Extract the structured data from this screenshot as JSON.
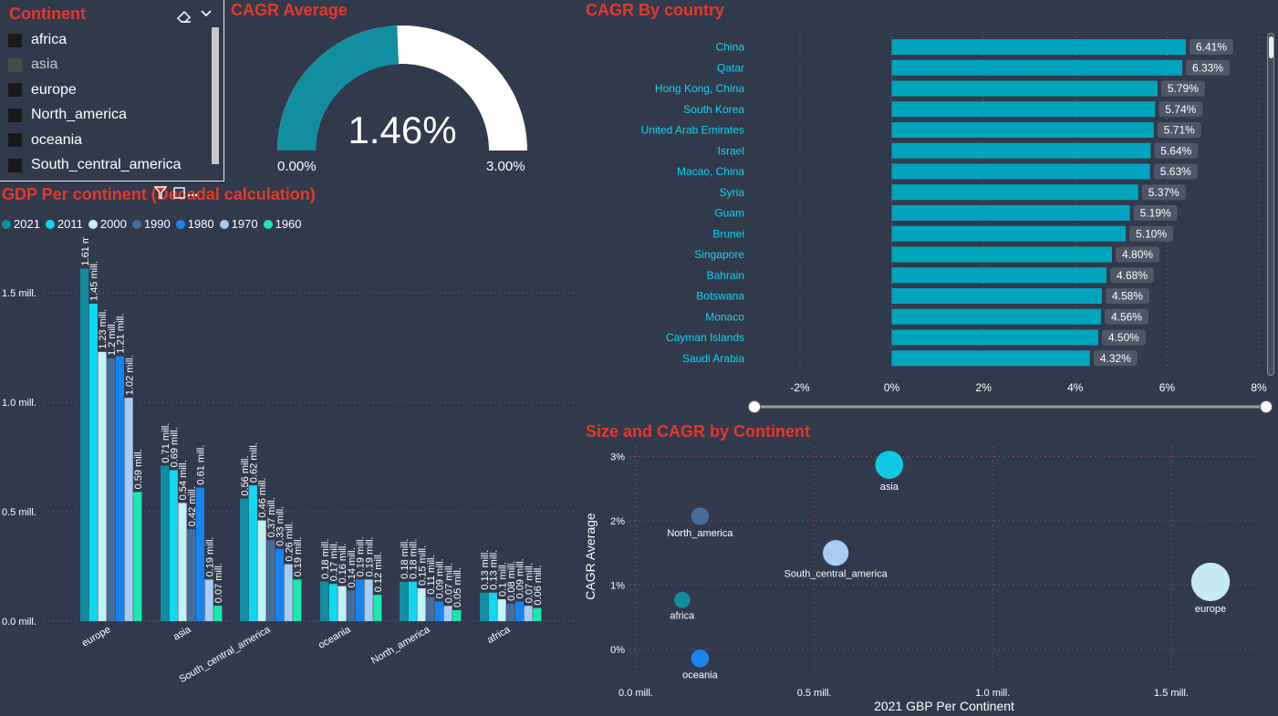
{
  "slicer": {
    "title": "Continent",
    "items": [
      {
        "label": "africa",
        "dim": false
      },
      {
        "label": "asia",
        "dim": true
      },
      {
        "label": "europe",
        "dim": false
      },
      {
        "label": "North_america",
        "dim": false
      },
      {
        "label": "oceania",
        "dim": false
      },
      {
        "label": "South_central_america",
        "dim": false
      }
    ]
  },
  "gauge": {
    "title": "CAGR Average",
    "value_label": "1.46%",
    "value": 1.46,
    "min_label": "0.00%",
    "max_label": "3.00%",
    "min": 0,
    "max": 3,
    "fill_color": "#118ea0",
    "track_color": "#ffffff"
  },
  "bar_title": "CAGR By country",
  "grouped_title": "GDP Per continent (Decadal calculation)",
  "scatter_title": "Size and CAGR by Continent",
  "chart_data": [
    {
      "type": "bar",
      "orientation": "horizontal",
      "title": "CAGR By country",
      "categories": [
        "China",
        "Qatar",
        "Hong Kong, China",
        "South Korea",
        "United Arab Emirates",
        "Israel",
        "Macao, China",
        "Syria",
        "Guam",
        "Brunei",
        "Singapore",
        "Bahrain",
        "Botswana",
        "Monaco",
        "Cayman Islands",
        "Saudi Arabia"
      ],
      "values": [
        6.41,
        6.33,
        5.79,
        5.74,
        5.71,
        5.64,
        5.63,
        5.37,
        5.19,
        5.1,
        4.8,
        4.68,
        4.58,
        4.56,
        4.5,
        4.32
      ],
      "value_labels": [
        "6.41%",
        "6.33%",
        "5.79%",
        "5.74%",
        "5.71%",
        "5.64%",
        "5.63%",
        "5.37%",
        "5.19%",
        "5.10%",
        "4.80%",
        "4.68%",
        "4.58%",
        "4.56%",
        "4.50%",
        "4.32%"
      ],
      "xlim": [
        -2,
        8
      ],
      "xticks": [
        -2,
        0,
        2,
        4,
        6,
        8
      ],
      "xtick_labels": [
        "-2%",
        "0%",
        "2%",
        "4%",
        "6%",
        "8%"
      ],
      "color": "#00a5bd",
      "grid": true
    },
    {
      "type": "bar",
      "title": "GDP Per continent (Decadal calculation)",
      "categories": [
        "europe",
        "asia",
        "South_central_america",
        "oceania",
        "North_america",
        "africa"
      ],
      "series": [
        {
          "name": "2021",
          "color": "#118ea0",
          "values": [
            1.61,
            0.71,
            0.56,
            0.18,
            0.18,
            0.13
          ]
        },
        {
          "name": "2011",
          "color": "#12d7f2",
          "values": [
            1.45,
            0.69,
            0.62,
            0.17,
            0.18,
            0.13
          ]
        },
        {
          "name": "2000",
          "color": "#c5f1f8",
          "values": [
            1.23,
            0.54,
            0.46,
            0.16,
            0.15,
            0.1
          ]
        },
        {
          "name": "1990",
          "color": "#466c9c",
          "values": [
            1.2,
            0.42,
            0.37,
            0.14,
            0.11,
            0.08
          ]
        },
        {
          "name": "1980",
          "color": "#1a83ee",
          "values": [
            1.21,
            0.61,
            0.33,
            0.19,
            0.09,
            0.09
          ]
        },
        {
          "name": "1970",
          "color": "#a7ccf5",
          "values": [
            1.02,
            0.19,
            0.26,
            0.19,
            0.07,
            0.07
          ]
        },
        {
          "name": "1960",
          "color": "#1be8b0",
          "values": [
            0.59,
            0.07,
            0.19,
            0.12,
            0.05,
            0.06
          ]
        }
      ],
      "value_labels": [
        [
          "1.61 mill.",
          "0.71 mill.",
          "0.56 mill.",
          "0.18 mill.",
          "0.18 mill.",
          "0.13 mill."
        ],
        [
          "1.45 mill.",
          "0.69 mill.",
          "0.62 mill.",
          "0.17 mill.",
          "0.18 mill.",
          "0.13 mill."
        ],
        [
          "1.23 mill.",
          "0.54 mill.",
          "0.46 mill.",
          "0.16 mill.",
          "0.15 mill.",
          "0.1 mill."
        ],
        [
          "1.2 mill.",
          "0.42 mill.",
          "0.37 mill.",
          "0.14 mill.",
          "0.11 mill.",
          "0.08 mill."
        ],
        [
          "1.21 mill.",
          "0.61 mill.",
          "0.33 mill.",
          "0.19 mill.",
          "0.09 mill.",
          "0.09 mill."
        ],
        [
          "1.02 mill.",
          "0.19 mill.",
          "0.26 mill.",
          "0.19 mill.",
          "0.07 mill.",
          "0.07 mill."
        ],
        [
          "0.59 mill.",
          "0.07 mill.",
          "0.19 mill.",
          "0.12 mill.",
          "0.05 mill.",
          "0.06 mill."
        ]
      ],
      "ylim": [
        0,
        1.7
      ],
      "yticks": [
        0,
        0.5,
        1.0,
        1.5
      ],
      "ytick_labels": [
        "0.0 mill.",
        "0.5 mill.",
        "1.0 mill.",
        "1.5 mill."
      ],
      "legend": "top-left",
      "grid": true
    },
    {
      "type": "scatter",
      "title": "Size and CAGR by Continent",
      "xlabel": "2021 GBP Per Continent",
      "ylabel": "CAGR Average",
      "xlim": [
        0,
        1.7
      ],
      "ylim": [
        -0.3,
        3.1
      ],
      "xticks": [
        0,
        0.5,
        1.0,
        1.5
      ],
      "xtick_labels": [
        "0.0 mill.",
        "0.5 mill.",
        "1.0 mill.",
        "1.5 mill."
      ],
      "yticks": [
        0,
        1,
        2,
        3
      ],
      "ytick_labels": [
        "0%",
        "1%",
        "2%",
        "3%"
      ],
      "points": [
        {
          "label": "asia",
          "x": 0.71,
          "y": 2.87,
          "size": 0.71,
          "color": "#12c8e6"
        },
        {
          "label": "North_america",
          "x": 0.18,
          "y": 2.07,
          "size": 0.18,
          "color": "#466c9c"
        },
        {
          "label": "South_central_america",
          "x": 0.56,
          "y": 1.5,
          "size": 0.56,
          "color": "#a7ccf5"
        },
        {
          "label": "africa",
          "x": 0.13,
          "y": 0.77,
          "size": 0.13,
          "color": "#118ea0"
        },
        {
          "label": "europe",
          "x": 1.61,
          "y": 1.05,
          "size": 1.61,
          "color": "#c5eaf2"
        },
        {
          "label": "oceania",
          "x": 0.18,
          "y": -0.14,
          "size": 0.18,
          "color": "#1a83ee"
        }
      ],
      "grid": true
    }
  ]
}
